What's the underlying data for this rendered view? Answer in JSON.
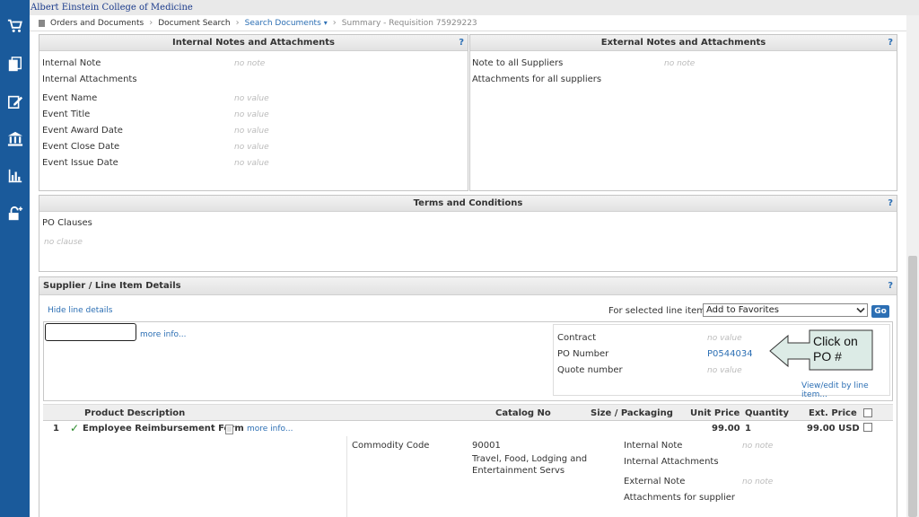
{
  "header": {
    "org": "Albert Einstein College of Medicine"
  },
  "breadcrumb": [
    "Orders and Documents",
    "Document Search",
    "Search Documents",
    "Summary - Requisition 75929223"
  ],
  "sidebar": {
    "icons": [
      "cart-icon",
      "documents-icon",
      "edit-icon",
      "bank-icon",
      "chart-icon",
      "lock-icon"
    ]
  },
  "internal": {
    "title": "Internal Notes and Attachments",
    "help": "?",
    "rows": [
      {
        "label": "Internal Note",
        "value": "no note"
      },
      {
        "label": "Internal Attachments",
        "value": ""
      },
      {
        "label": "Event Name",
        "value": "no value"
      },
      {
        "label": "Event Title",
        "value": "no value"
      },
      {
        "label": "Event Award Date",
        "value": "no value"
      },
      {
        "label": "Event Close Date",
        "value": "no value"
      },
      {
        "label": "Event Issue Date",
        "value": "no value"
      }
    ]
  },
  "external": {
    "title": "External Notes and Attachments",
    "help": "?",
    "rows": [
      {
        "label": "Note to all Suppliers",
        "value": "no note"
      },
      {
        "label": "Attachments for all suppliers",
        "value": ""
      }
    ]
  },
  "terms": {
    "title": "Terms and Conditions",
    "help": "?",
    "label": "PO Clauses",
    "value": "no clause"
  },
  "supplier": {
    "title": "Supplier / Line Item Details",
    "help": "?",
    "hide_link": "Hide line details",
    "for_selected": "For selected line items",
    "action_select": "Add to Favorites",
    "go": "Go",
    "more_info": "more info...",
    "contract_label": "Contract",
    "contract_value": "no value",
    "po_label": "PO Number",
    "po_value": "P0544034",
    "quote_label": "Quote number",
    "quote_value": "no value",
    "view_edit": "View/edit by line item...",
    "callout": "Click on PO #",
    "columns": [
      "Product Description",
      "Catalog No",
      "Size / Packaging",
      "Unit Price",
      "Quantity",
      "Ext. Price"
    ],
    "line": {
      "num": "1",
      "desc": "Employee Reimbursement Form",
      "more_info": "more info...",
      "unit_price": "99.00",
      "quantity": "1",
      "ext_price": "99.00 USD",
      "commodity_label": "Commodity Code",
      "commodity_code": "90001",
      "commodity_desc": "Travel, Food, Lodging and Entertainment Servs",
      "internal_note_label": "Internal Note",
      "internal_note_value": "no note",
      "internal_att_label": "Internal Attachments",
      "external_note_label": "External Note",
      "external_note_value": "no note",
      "att_supplier_label": "Attachments for supplier"
    }
  }
}
